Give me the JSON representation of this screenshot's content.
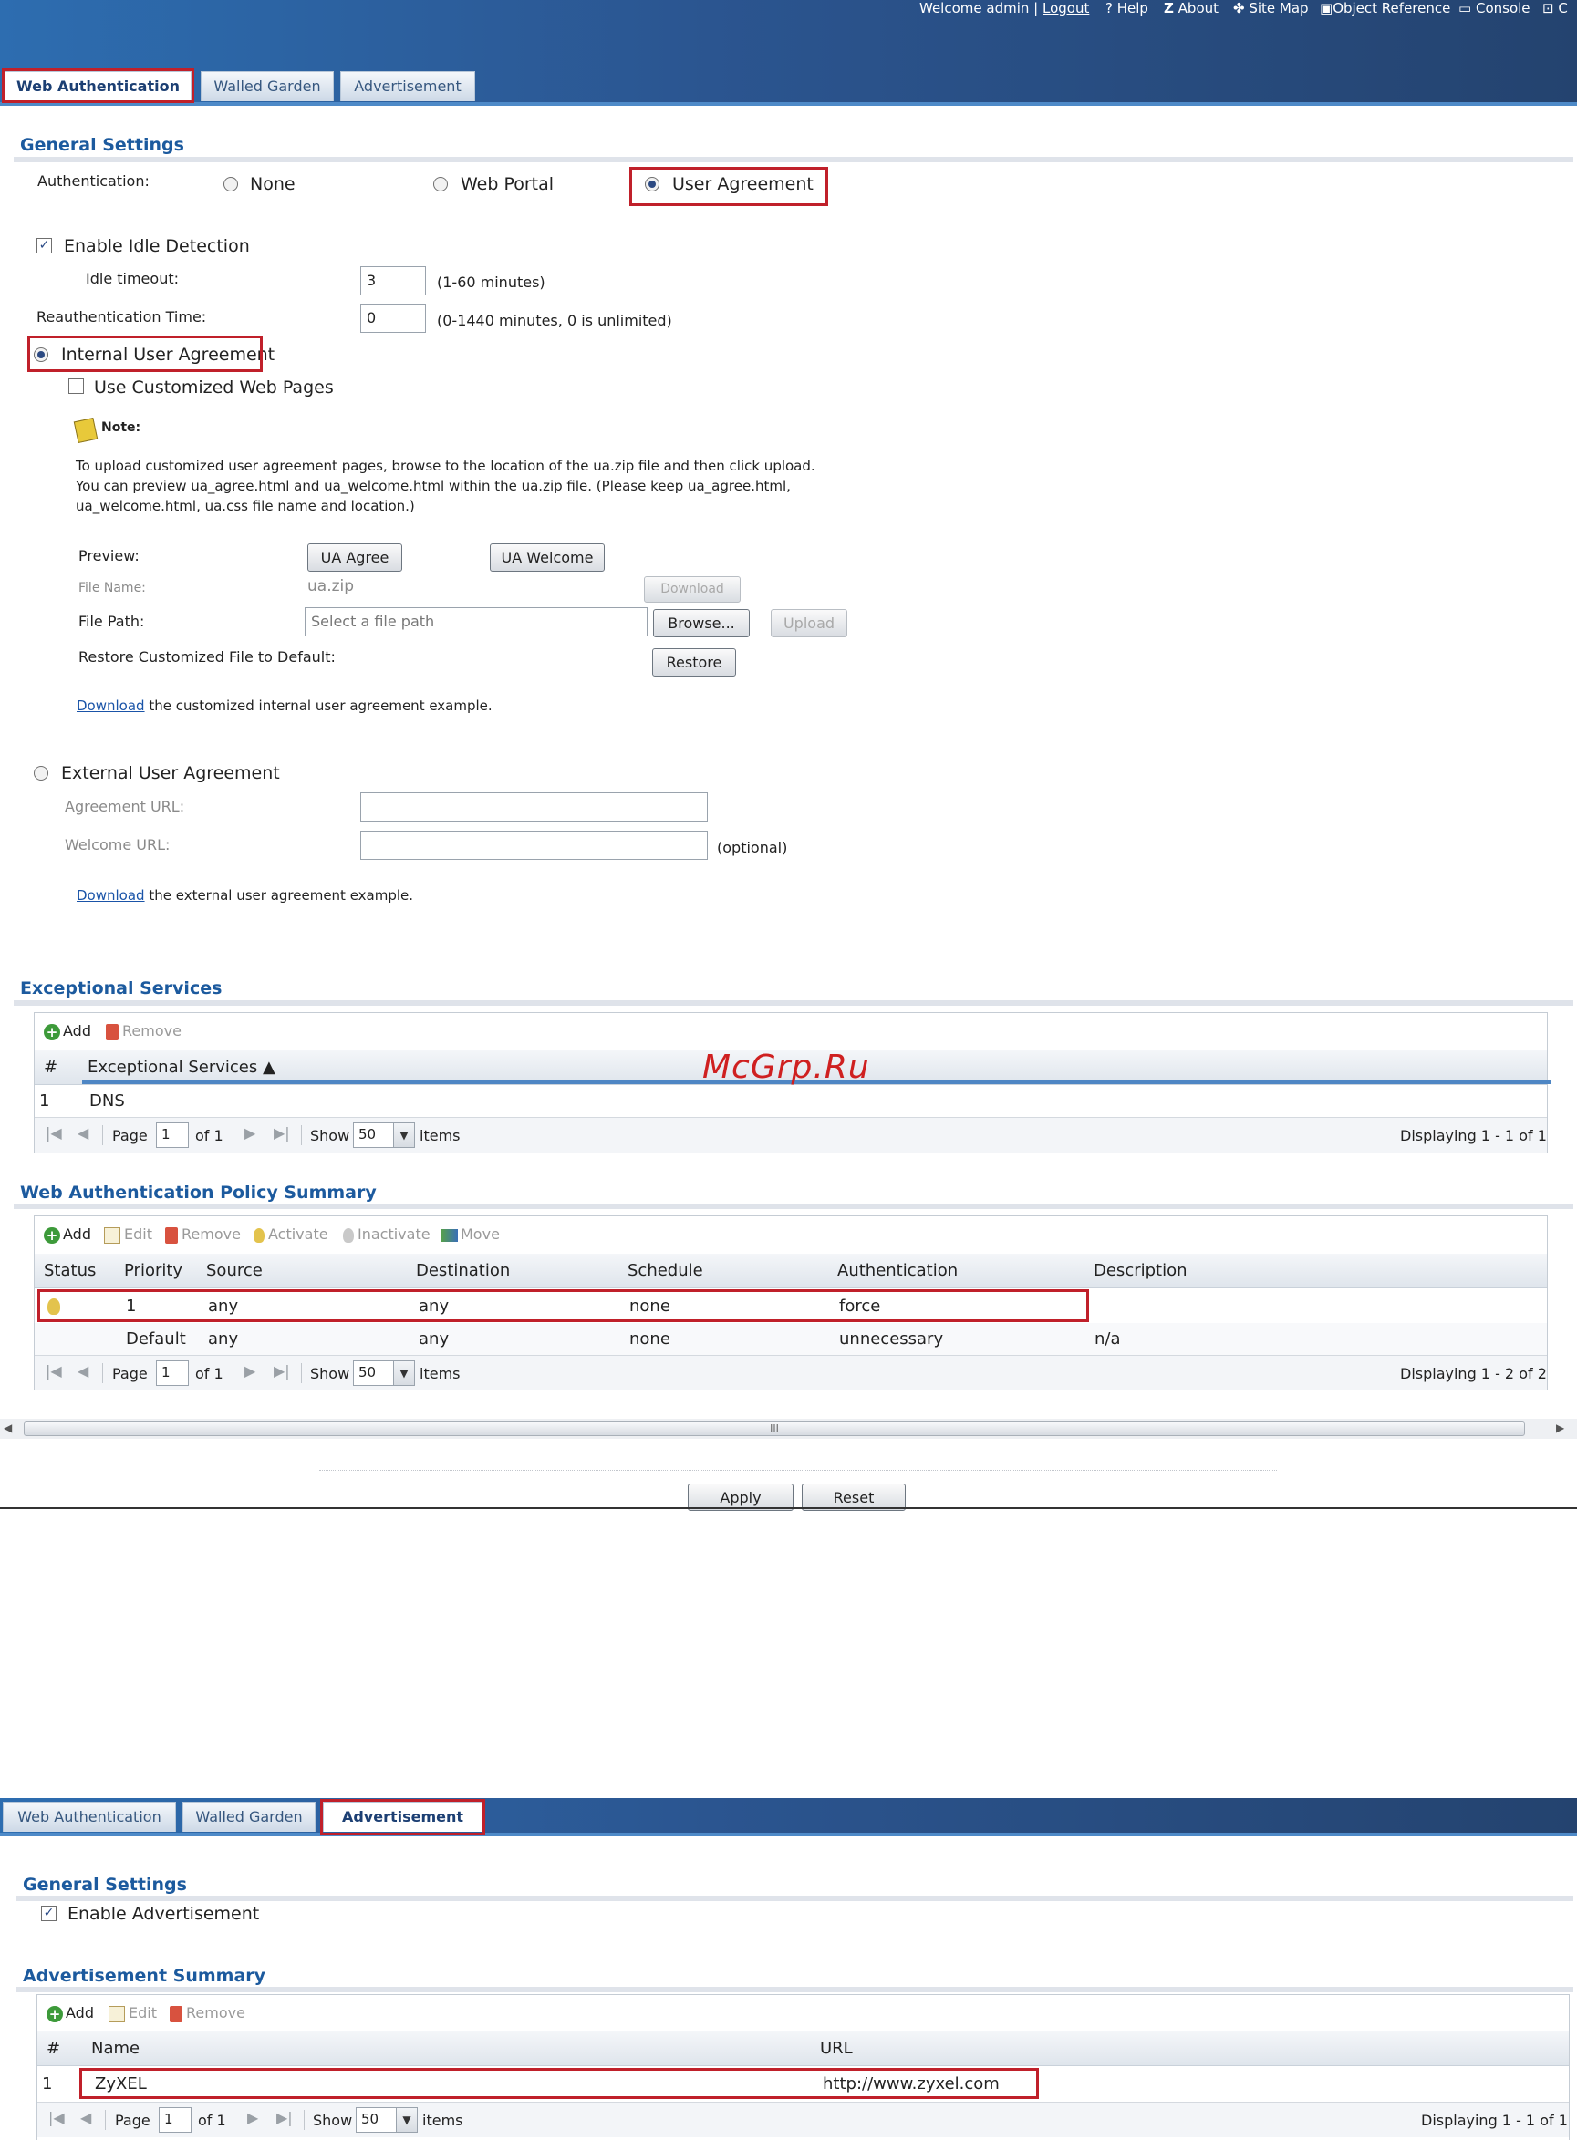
{
  "top": {
    "welcome": "Welcome admin |",
    "logout": "Logout",
    "links": [
      {
        "icon": "help-icon",
        "label": "Help",
        "glyph": "?"
      },
      {
        "icon": "about-icon",
        "label": "About",
        "glyph": "Z"
      },
      {
        "icon": "site-map-icon",
        "label": "Site Map",
        "glyph": "✤"
      },
      {
        "icon": "object-reference-icon",
        "label": "Object Reference",
        "glyph": "▣"
      },
      {
        "icon": "console-icon",
        "label": "Console",
        "glyph": "▭"
      },
      {
        "icon": "cli-icon",
        "label": "C",
        "glyph": "⊡"
      }
    ]
  },
  "screen1": {
    "tabs": [
      "Web Authentication",
      "Walled Garden",
      "Advertisement"
    ],
    "active_tab": "Web Authentication",
    "general_settings": "General Settings",
    "authentication_label": "Authentication:",
    "auth_options": [
      "None",
      "Web Portal",
      "User Agreement"
    ],
    "auth_selected": "User Agreement",
    "enable_idle": "Enable Idle Detection",
    "idle_timeout_label": "Idle timeout:",
    "idle_timeout_value": "3",
    "idle_timeout_hint": "(1-60 minutes)",
    "reauth_label": "Reauthentication Time:",
    "reauth_value": "0",
    "reauth_hint": "(0-1440 minutes, 0 is unlimited)",
    "internal_agreement": "Internal User Agreement",
    "use_custom_pages": "Use Customized Web Pages",
    "note_label": "Note:",
    "note_lines": [
      "To upload customized user agreement pages, browse to the location of the ua.zip file and then click upload.",
      "You can preview ua_agree.html and ua_welcome.html within the ua.zip file. (Please keep ua_agree.html,",
      "ua_welcome.html, ua.css file name and location.)"
    ],
    "preview_label": "Preview:",
    "ua_agree_button": "UA Agree",
    "ua_welcome_button": "UA Welcome",
    "file_name_label": "File Name:",
    "file_name_value": "ua.zip",
    "download_button": "Download",
    "file_path_label": "File Path:",
    "file_path_placeholder": "Select a file path",
    "browse_button": "Browse...",
    "upload_button": "Upload",
    "restore_label": "Restore Customized File to Default:",
    "restore_button": "Restore",
    "download_link_internal": "Download",
    "download_text_internal": "the customized internal user agreement example.",
    "external_agreement": "External User Agreement",
    "agreement_url_label": "Agreement URL:",
    "welcome_url_label": "Welcome URL:",
    "optional_hint": "(optional)",
    "download_link_external": "Download",
    "download_text_external": "the external user agreement example.",
    "exceptional_title": "Exceptional Services",
    "exceptional_toolbar": {
      "add": "Add",
      "remove": "Remove"
    },
    "exceptional_headers": [
      "#",
      "Exceptional Services ▲"
    ],
    "exceptional_rows": [
      {
        "num": "1",
        "service": "DNS"
      }
    ],
    "exceptional_pager": {
      "page": "Page",
      "page_value": "1",
      "of": "of 1",
      "show": "Show",
      "show_value": "50",
      "items": "items",
      "displaying": "Displaying 1 - 1 of 1"
    },
    "watermark": "McGrp.Ru",
    "policy_title": "Web Authentication Policy Summary",
    "policy_toolbar": {
      "add": "Add",
      "edit": "Edit",
      "remove": "Remove",
      "activate": "Activate",
      "inactivate": "Inactivate",
      "move": "Move"
    },
    "policy_headers": [
      "Status",
      "Priority",
      "Source",
      "Destination",
      "Schedule",
      "Authentication",
      "Description"
    ],
    "policy_rows": [
      {
        "status": "bulb-on",
        "priority": "1",
        "source": "any",
        "destination": "any",
        "schedule": "none",
        "authentication": "force",
        "description": ""
      },
      {
        "status": "",
        "priority": "Default",
        "source": "any",
        "destination": "any",
        "schedule": "none",
        "authentication": "unnecessary",
        "description": "n/a"
      }
    ],
    "policy_pager": {
      "page": "Page",
      "page_value": "1",
      "of": "of 1",
      "show": "Show",
      "show_value": "50",
      "items": "items",
      "displaying": "Displaying 1 - 2 of 2"
    },
    "scroll_grip": "III",
    "apply_button": "Apply",
    "reset_button": "Reset"
  },
  "screen2": {
    "tabs": [
      "Web Authentication",
      "Walled Garden",
      "Advertisement"
    ],
    "active_tab": "Advertisement",
    "general_settings": "General Settings",
    "enable_ad": "Enable Advertisement",
    "summary_title": "Advertisement Summary",
    "toolbar": {
      "add": "Add",
      "edit": "Edit",
      "remove": "Remove"
    },
    "headers": [
      "#",
      "Name",
      "URL"
    ],
    "rows": [
      {
        "num": "1",
        "name": "ZyXEL",
        "url": "http://www.zyxel.com"
      }
    ],
    "pager": {
      "page": "Page",
      "page_value": "1",
      "of": "of 1",
      "show": "Show",
      "show_value": "50",
      "items": "items",
      "displaying": "Displaying 1 - 1 of 1"
    }
  }
}
